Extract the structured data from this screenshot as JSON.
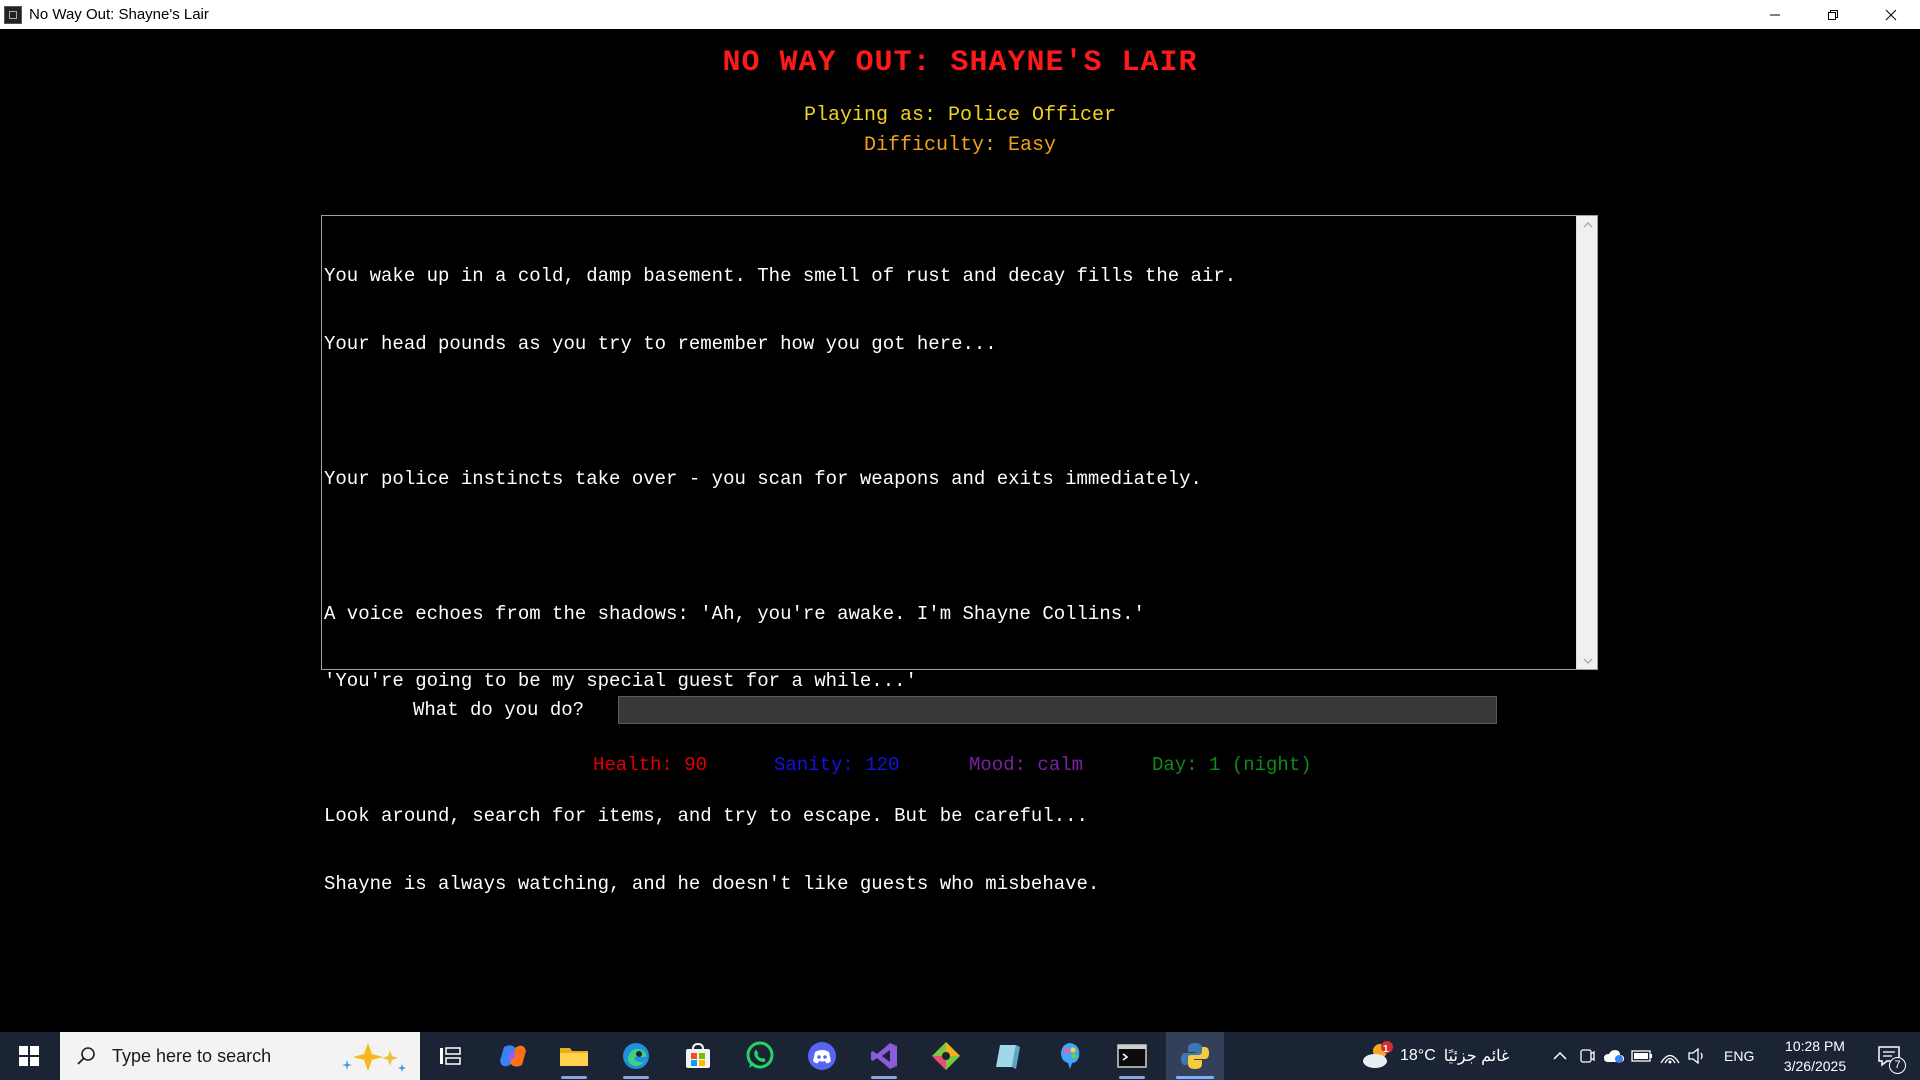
{
  "window": {
    "title": "No Way Out: Shayne's Lair"
  },
  "game": {
    "title": "NO WAY OUT: SHAYNE'S LAIR",
    "playing_as": "Playing as: Police Officer",
    "difficulty": "Difficulty: Easy",
    "story_lines": [
      "You wake up in a cold, damp basement. The smell of rust and decay fills the air.",
      "Your head pounds as you try to remember how you got here...",
      "",
      "Your police instincts take over - you scan for weapons and exits immediately.",
      "",
      "A voice echoes from the shadows: 'Ah, you're awake. I'm Shayne Collins.'",
      "'You're going to be my special guest for a while...'",
      "",
      "Look around, search for items, and try to escape. But be careful...",
      "Shayne is always watching, and he doesn't like guests who misbehave."
    ],
    "prompt": "What do you do?",
    "command_value": "",
    "stats": {
      "health": "Health: 90",
      "sanity": "Sanity: 120",
      "mood": "Mood: calm",
      "day": "Day: 1 (night)"
    },
    "colors": {
      "title": "#ff1a1a",
      "playing_as": "#f2d21c",
      "difficulty": "#f0a21c",
      "health": "#e00000",
      "sanity": "#1212e6",
      "mood": "#7d1fa8",
      "day": "#0e8a1a"
    }
  },
  "taskbar": {
    "search_placeholder": "Type here to search",
    "apps": [
      "copilot-icon",
      "file-explorer-icon",
      "edge-icon",
      "store-icon",
      "whatsapp-icon",
      "discord-icon",
      "visual-studio-icon",
      "git-icon",
      "notepad-icon",
      "paint-icon",
      "terminal-icon",
      "python-icon"
    ],
    "weather": {
      "temp": "18°C",
      "condition": "غائم جزئيًا",
      "badge": "1"
    },
    "language": "ENG",
    "time": "10:28 PM",
    "date": "3/26/2025",
    "notification_count": "7"
  }
}
